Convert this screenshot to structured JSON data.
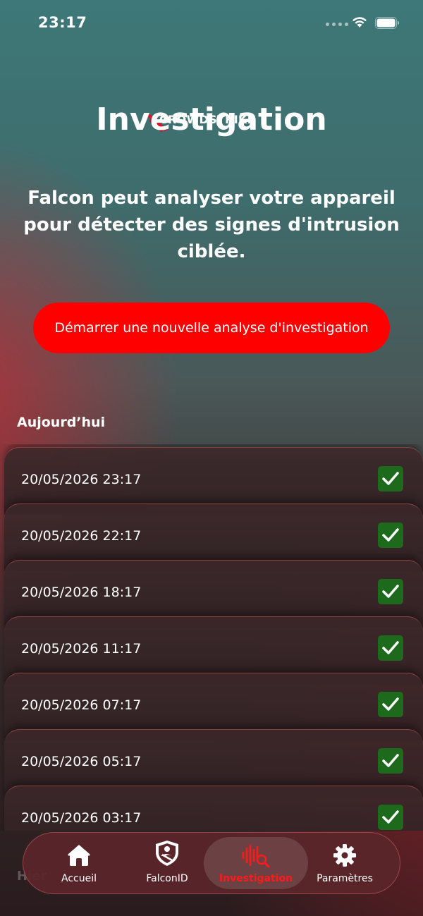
{
  "status_bar": {
    "time": "23:17"
  },
  "brand": {
    "name": "CROWDSTRIKE"
  },
  "page": {
    "title": "Investigation",
    "description": "Falcon peut analyser votre appareil pour détecter des signes d'intrusion ciblée."
  },
  "start_button": {
    "label": "Démarrer une nouvelle analyse d'investigation"
  },
  "history": {
    "section_label": "Aujourd’hui",
    "items": [
      {
        "date": "20/05/2026 23:17",
        "status": "ok"
      },
      {
        "date": "20/05/2026 22:17",
        "status": "ok"
      },
      {
        "date": "20/05/2026 18:17",
        "status": "ok"
      },
      {
        "date": "20/05/2026 11:17",
        "status": "ok"
      },
      {
        "date": "20/05/2026 07:17",
        "status": "ok"
      },
      {
        "date": "20/05/2026 05:17",
        "status": "ok"
      },
      {
        "date": "20/05/2026 03:17",
        "status": "ok"
      }
    ],
    "peek_label": "Hier"
  },
  "tabs": [
    {
      "label": "Accueil",
      "icon": "home-icon"
    },
    {
      "label": "FalconID",
      "icon": "shield-icon"
    },
    {
      "label": "Investigation",
      "icon": "investigation-icon",
      "active": true
    },
    {
      "label": "Paramètres",
      "icon": "gear-icon"
    }
  ],
  "colors": {
    "accent": "#ff0000",
    "check_bg": "#1d6a1d",
    "active_tab": "#ff1a1a"
  }
}
